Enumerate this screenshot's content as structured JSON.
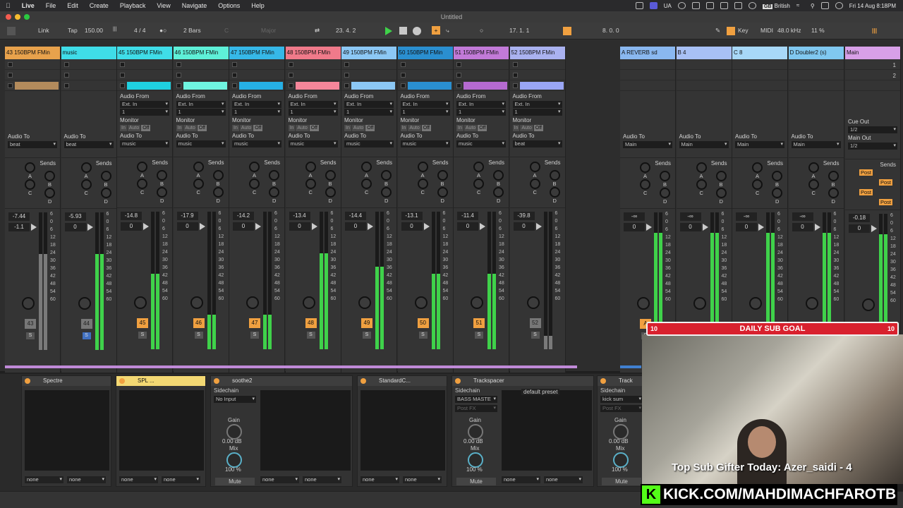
{
  "menubar": {
    "app": "Live",
    "items": [
      "File",
      "Edit",
      "Create",
      "Playback",
      "View",
      "Navigate",
      "Options",
      "Help"
    ],
    "lang_code": "UA",
    "kbd_badge": "GB",
    "keyboard_layout": "British",
    "datetime": "Fri 14 Aug  8:18PM"
  },
  "window": {
    "title": "Untitled"
  },
  "transport": {
    "link": "Link",
    "tap": "Tap",
    "tempo": "150.00",
    "signature": "4 / 4",
    "quantize": "2 Bars",
    "key": "C",
    "scale": "Major",
    "position": "23.   4.   2",
    "loop_start": "17.   1.   1",
    "loop_length": "8.   0.   0",
    "key_label": "Key",
    "midi_label": "MIDI",
    "sample_rate": "48.0 kHz",
    "cpu": "11 %"
  },
  "tracks": [
    {
      "name": "43 150BPM FMin",
      "color": "#e8a24c",
      "clip": "#b38b5c",
      "in_type": "",
      "in_chan": "",
      "monitor": "",
      "audio_to": "beat",
      "vol": "-7.44",
      "vol2": "-1.1",
      "pan": "",
      "num": "43",
      "num_on": false,
      "meter": 0.7,
      "meter_gray": true,
      "solo_blue": false
    },
    {
      "name": "music",
      "color": "#3fdde8",
      "clip": "",
      "in_type": "",
      "in_chan": "",
      "monitor": "",
      "audio_to": "beat",
      "vol": "-5.93",
      "vol2": "0",
      "pan": "",
      "num": "44",
      "num_on": false,
      "meter": 0.7,
      "meter_gray": false,
      "solo_blue": true
    },
    {
      "name": "45 150BPM FMin",
      "color": "#3fdde8",
      "clip": "#1fd0e0",
      "in_type": "Ext. In",
      "in_chan": "1",
      "monitor": "Off",
      "audio_to": "music",
      "vol": "-14.8",
      "vol2": "0",
      "pan": "",
      "num": "45",
      "num_on": true,
      "meter": 0.55,
      "meter_gray": false,
      "solo_blue": false
    },
    {
      "name": "46 150BPM FMin",
      "color": "#5ef0d8",
      "clip": "#6ff5e0",
      "in_type": "Ext. In",
      "in_chan": "1",
      "monitor": "Off",
      "audio_to": "music",
      "vol": "-17.9",
      "vol2": "0",
      "pan": "",
      "num": "46",
      "num_on": true,
      "meter": 0.25,
      "meter_gray": false,
      "solo_blue": false
    },
    {
      "name": "47 150BPM FMin",
      "color": "#36b8e8",
      "clip": "#26b0e6",
      "in_type": "Ext. In",
      "in_chan": "1",
      "monitor": "Off",
      "audio_to": "music",
      "vol": "-14.2",
      "vol2": "0",
      "pan": "",
      "num": "47",
      "num_on": true,
      "meter": 0.25,
      "meter_gray": false,
      "solo_blue": false
    },
    {
      "name": "48 150BPM FMin",
      "color": "#f07a8a",
      "clip": "#f5869a",
      "in_type": "Ext. In",
      "in_chan": "1",
      "monitor": "Off",
      "audio_to": "music",
      "vol": "-13.4",
      "vol2": "0",
      "pan": "",
      "num": "48",
      "num_on": true,
      "meter": 0.7,
      "meter_gray": false,
      "solo_blue": false
    },
    {
      "name": "49 150BPM FMin",
      "color": "#8cc8f5",
      "clip": "#8cc8f5",
      "in_type": "Ext. In",
      "in_chan": "1",
      "monitor": "Off",
      "audio_to": "music",
      "vol": "-14.4",
      "vol2": "0",
      "pan": "",
      "num": "49",
      "num_on": true,
      "meter": 0.6,
      "meter_gray": false,
      "solo_blue": false
    },
    {
      "name": "50 150BPM FMin",
      "color": "#2a8fd0",
      "clip": "#2a8fd0",
      "in_type": "Ext. In",
      "in_chan": "1",
      "monitor": "Off",
      "audio_to": "music",
      "vol": "-13.1",
      "vol2": "0",
      "pan": "",
      "num": "50",
      "num_on": true,
      "meter": 0.55,
      "meter_gray": false,
      "solo_blue": false
    },
    {
      "name": "51 150BPM FMin",
      "color": "#c27ad8",
      "clip": "#b56ad0",
      "in_type": "Ext. In",
      "in_chan": "1",
      "monitor": "Off",
      "audio_to": "music",
      "vol": "-11.4",
      "vol2": "0",
      "pan": "",
      "num": "51",
      "num_on": true,
      "meter": 0.55,
      "meter_gray": false,
      "solo_blue": false
    },
    {
      "name": "52 150BPM FMin",
      "color": "#aab2f0",
      "clip": "#9aa6f5",
      "in_type": "Ext. In",
      "in_chan": "1",
      "monitor": "Off",
      "audio_to": "beat",
      "vol": "-39.8",
      "vol2": "0",
      "pan": "",
      "num": "52",
      "num_on": false,
      "meter": 0.1,
      "meter_gray": true,
      "solo_blue": false
    }
  ],
  "returns": [
    {
      "name": "A REVERB sd",
      "color": "#8ab8f0",
      "audio_to": "Main",
      "vol": "-∞",
      "vol2": "0",
      "num": "A"
    },
    {
      "name": "B 4",
      "color": "#a8c0f5",
      "audio_to": "Main",
      "vol": "-∞",
      "vol2": "0",
      "num": ""
    },
    {
      "name": "C 8",
      "color": "#a8d8f8",
      "audio_to": "Main",
      "vol": "-∞",
      "vol2": "0",
      "num": ""
    },
    {
      "name": "D Doubler2 (s)",
      "color": "#80c8f0",
      "audio_to": "Main",
      "vol": "-∞",
      "vol2": "0",
      "num": ""
    }
  ],
  "main": {
    "name": "Main",
    "color": "#d8a0e8",
    "cue_out_label": "Cue Out",
    "cue_out": "1/2",
    "main_out_label": "Main Out",
    "main_out": "1/2",
    "vol": "-0.18",
    "vol2": "0",
    "scenes": [
      "1",
      "2"
    ],
    "post": [
      "Post",
      "Post",
      "Post",
      "Post"
    ]
  },
  "labels": {
    "audio_from": "Audio From",
    "monitor": "Monitor",
    "audio_to": "Audio To",
    "sends": "Sends",
    "mon_in": "In",
    "mon_auto": "Auto",
    "send_a": "A",
    "send_b": "B",
    "send_c": "C",
    "send_d": "D",
    "solo": "S",
    "scale": [
      "6",
      "0",
      "6",
      "12",
      "18",
      "24",
      "30",
      "36",
      "42",
      "48",
      "54",
      "60"
    ],
    "left_scale": [
      "3",
      "0",
      "3",
      "12",
      "18",
      "24",
      "30",
      "36",
      "42",
      "48",
      "54",
      "60"
    ]
  },
  "devices": [
    {
      "name": "Spectre",
      "selected": false,
      "bottom": [
        "none",
        "none"
      ]
    },
    {
      "name": "SPL ...",
      "selected": true,
      "bottom": [
        "none",
        "none"
      ]
    },
    {
      "name": "soothe2",
      "selected": false,
      "sidechain_label": "Sidechain",
      "sidechain": "No Input",
      "gain_label": "Gain",
      "gain": "0.00 dB",
      "mix_label": "Mix",
      "mix": "100 %",
      "mute": "Mute",
      "bottom": [
        "none",
        "none"
      ]
    },
    {
      "name": "StandardC...",
      "selected": false,
      "bottom": [
        "none",
        "none"
      ]
    },
    {
      "name": "Trackspacer",
      "selected": false,
      "sidechain_label": "Sidechain",
      "sidechain": "BASS MASTE",
      "postfx": "Post FX",
      "gain_label": "Gain",
      "gain": "0.00 dB",
      "mix_label": "Mix",
      "mix": "100 %",
      "mute": "Mute",
      "preset": "default preset",
      "bottom": [
        "none",
        "none"
      ]
    },
    {
      "name": "Track",
      "selected": false,
      "sidechain_label": "Sidechain",
      "sidechain": "kick sum",
      "postfx": "Post FX",
      "gain_label": "Gain",
      "gain": "0.00 dB",
      "mix_label": "Mix",
      "mix": "100 %",
      "mute": "Mute"
    }
  ],
  "overlay": {
    "goal_left": "10",
    "goal_title": "DAILY SUB GOAL",
    "goal_right": "10",
    "gifter": "Top Sub Gifter Today: Azer_saidi - 4",
    "kick_logo": "K",
    "kick_url": "KICK.COM/MAHDIMACHFAROTB"
  }
}
